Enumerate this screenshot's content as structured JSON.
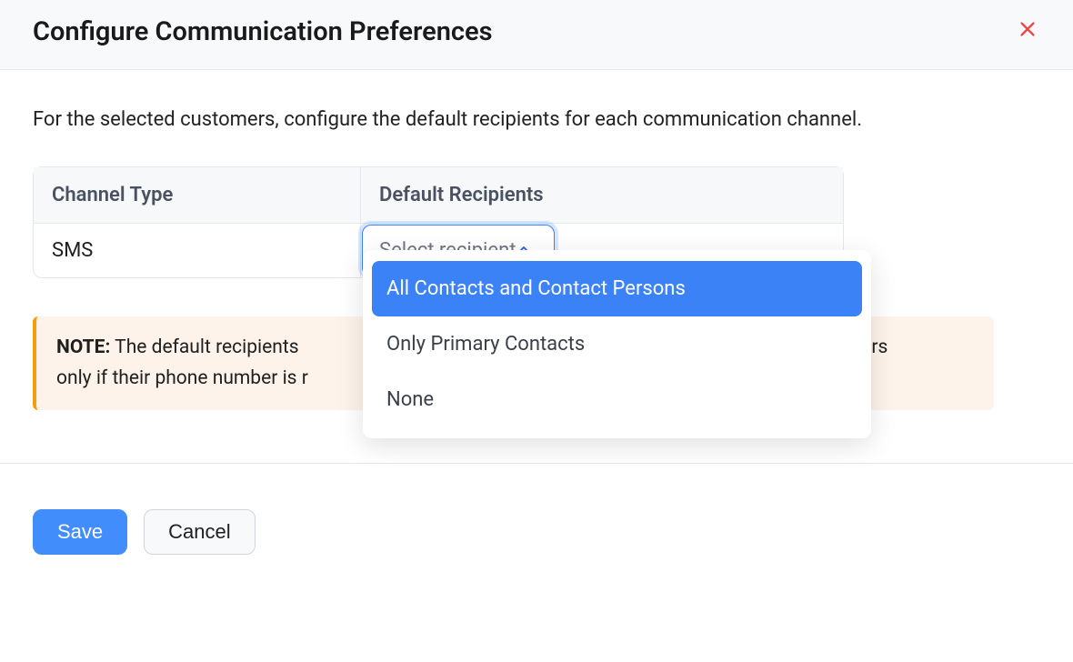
{
  "header": {
    "title": "Configure Communication Preferences"
  },
  "body": {
    "description": "For the selected customers, configure the default recipients for each communication channel."
  },
  "table": {
    "cols": {
      "channel": "Channel Type",
      "recipients": "Default Recipients"
    },
    "row": {
      "channel": "SMS",
      "select_placeholder": "Select recipient"
    }
  },
  "dropdown": {
    "options": [
      "All Contacts and Contact Persons",
      "Only Primary Contacts",
      "None"
    ]
  },
  "note": {
    "label": "NOTE:",
    "text_prefix": " The default recipients ",
    "text_middle": "customers",
    "text_suffix": "only if their phone number is r"
  },
  "footer": {
    "save": "Save",
    "cancel": "Cancel"
  }
}
